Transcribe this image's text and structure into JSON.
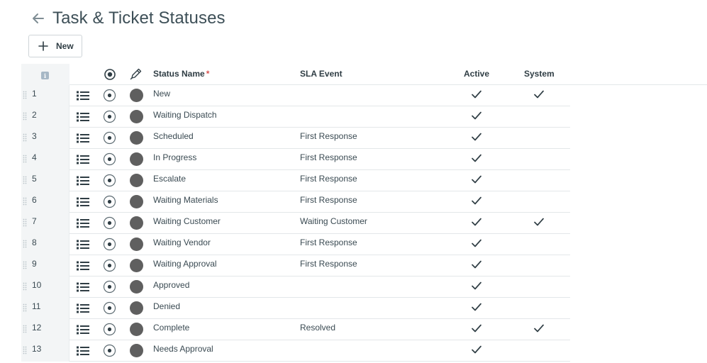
{
  "page": {
    "title": "Task & Ticket Statuses",
    "back_icon": "arrow-left-icon"
  },
  "toolbar": {
    "new_label": "New",
    "new_icon": "plus-icon"
  },
  "table": {
    "headers": {
      "info_icon": "i",
      "status_name": "Status Name",
      "required_mark": "*",
      "sla_event": "SLA Event",
      "active": "Active",
      "system": "System"
    },
    "rows": [
      {
        "num": "1",
        "name": "New",
        "sla": "",
        "active": true,
        "system": true
      },
      {
        "num": "2",
        "name": "Waiting Dispatch",
        "sla": "",
        "active": true,
        "system": false
      },
      {
        "num": "3",
        "name": "Scheduled",
        "sla": "First Response",
        "active": true,
        "system": false
      },
      {
        "num": "4",
        "name": "In Progress",
        "sla": "First Response",
        "active": true,
        "system": false
      },
      {
        "num": "5",
        "name": "Escalate",
        "sla": "First Response",
        "active": true,
        "system": false
      },
      {
        "num": "6",
        "name": "Waiting Materials",
        "sla": "First Response",
        "active": true,
        "system": false
      },
      {
        "num": "7",
        "name": "Waiting Customer",
        "sla": "Waiting Customer",
        "active": true,
        "system": true
      },
      {
        "num": "8",
        "name": "Waiting Vendor",
        "sla": "First Response",
        "active": true,
        "system": false
      },
      {
        "num": "9",
        "name": "Waiting Approval",
        "sla": "First Response",
        "active": true,
        "system": false
      },
      {
        "num": "10",
        "name": "Approved",
        "sla": "",
        "active": true,
        "system": false
      },
      {
        "num": "11",
        "name": "Denied",
        "sla": "",
        "active": true,
        "system": false
      },
      {
        "num": "12",
        "name": "Complete",
        "sla": "Resolved",
        "active": true,
        "system": true
      },
      {
        "num": "13",
        "name": "Needs Approval",
        "sla": "",
        "active": true,
        "system": false
      }
    ]
  },
  "colors": {
    "status_dot": "#5f5f5f",
    "accent_text": "#2f3d44",
    "required": "#d9534f"
  }
}
